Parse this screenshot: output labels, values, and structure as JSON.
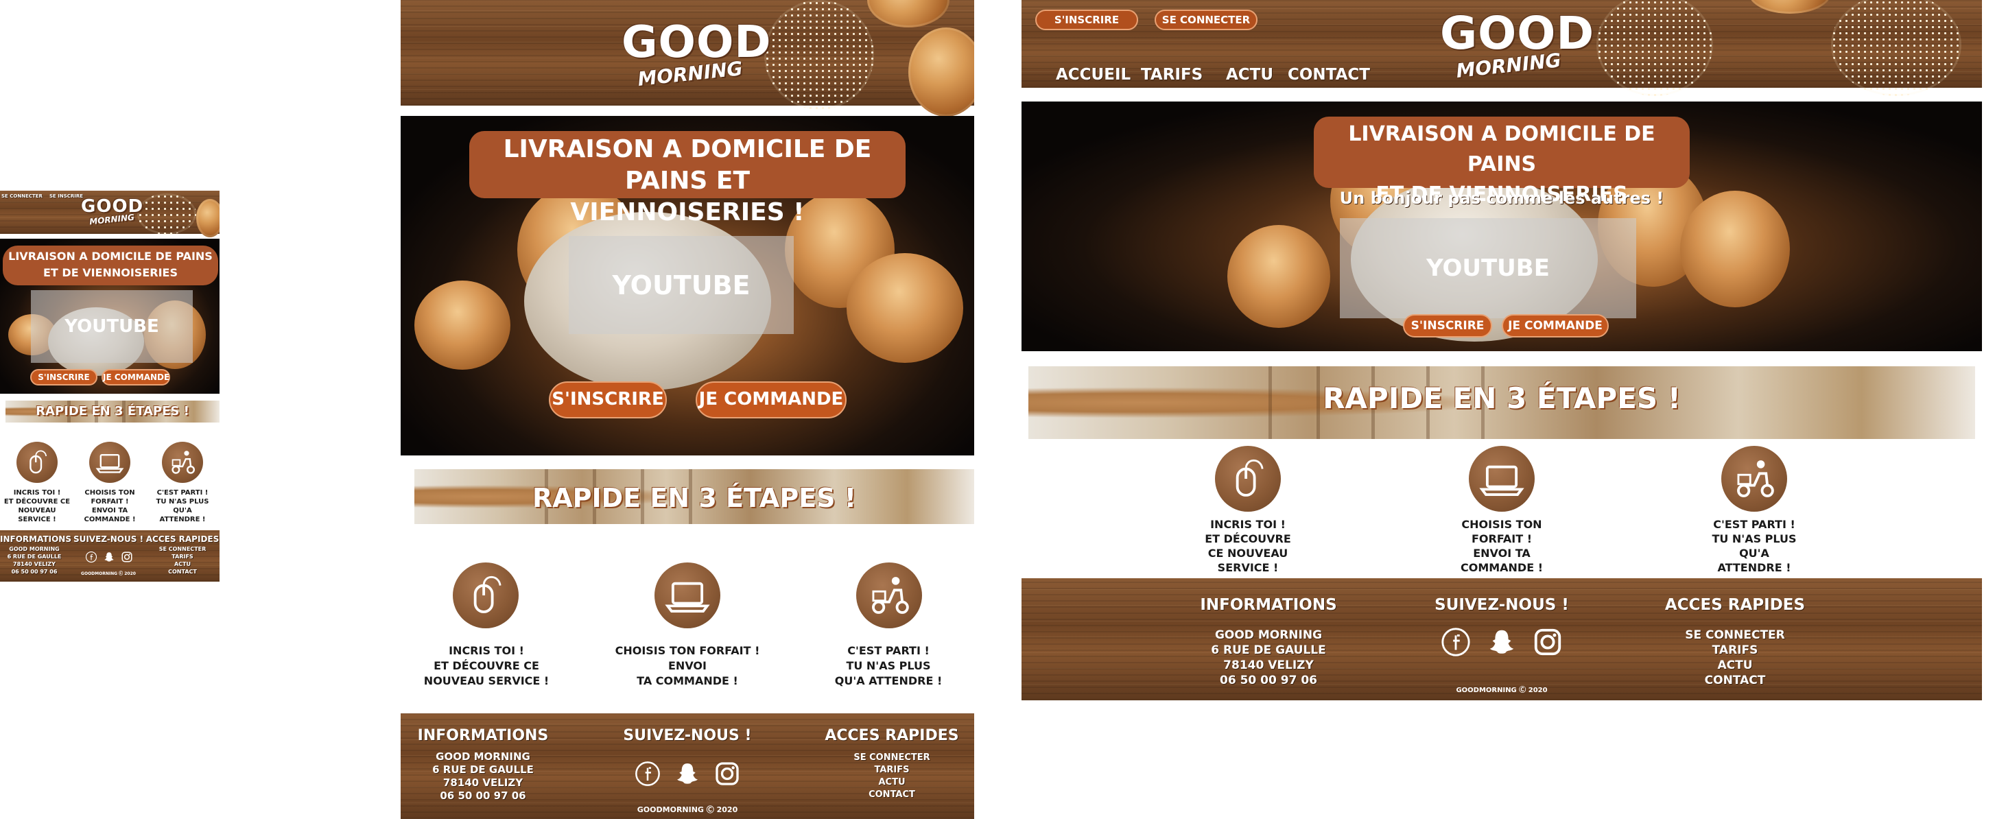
{
  "brand": {
    "logo_top": "GOOD",
    "logo_bottom": "MORNING"
  },
  "colors": {
    "accent": "#c4571e",
    "banner": "#a8532b",
    "wood": "#6f4424"
  },
  "nav": {
    "accueil": "ACCUEIL",
    "tarifs": "TARIFS",
    "actu": "ACTU",
    "contact": "CONTACT"
  },
  "auth": {
    "signup": "S'INSCRIRE",
    "login": "SE CONNECTER",
    "signup_alt": "SE INSCRIRE",
    "login_short": "SE CONNECTER"
  },
  "hero": {
    "title_desktop": "LIVRAISON A DOMICILE DE  PAINS\nET DE VIENNOISERIES",
    "title_tablet": "LIVRAISON A DOMICILE DE PAINS ET\nVIENNOISERIES !",
    "title_mobile": "LIVRAISON A DOMICILE DE  PAINS\nET DE VIENNOISERIES",
    "subtitle": "Un bonjour pas comme les autres !",
    "video_label": "YOUTUBE",
    "cta_signup": "S'INSCRIRE",
    "cta_order": "JE COMMANDE"
  },
  "steps": {
    "title": "RAPIDE EN 3 ÉTAPES !",
    "items": [
      {
        "icon": "mouse-icon",
        "desktop": "INCRIS TOI !\nET DÉCOUVRE\nCE NOUVEAU\nSERVICE !",
        "tablet": "INCRIS TOI !\nET DÉCOUVRE CE\nNOUVEAU SERVICE !",
        "mobile": "INCRIS TOI !\nET DÉCOUVRE CE\nNOUVEAU\nSERVICE !"
      },
      {
        "icon": "laptop-icon",
        "desktop": "CHOISIS TON\nFORFAIT !\nENVOI TA\nCOMMANDE !",
        "tablet": "CHOISIS TON FORFAIT !\nENVOI\nTA COMMANDE !",
        "mobile": "CHOISIS TON\nFORFAIT !\nENVOI TA\nCOMMANDE !"
      },
      {
        "icon": "delivery-scooter-icon",
        "desktop": "C'EST PARTI !\nTU N'AS PLUS\nQU'A\nATTENDRE !",
        "tablet": "C'EST PARTI !\nTU N'AS PLUS\nQU'A ATTENDRE !",
        "mobile": "C'EST PARTI !\nTU N'AS PLUS\nQU'A\nATTENDRE !"
      }
    ]
  },
  "footer": {
    "info_title": "INFORMATIONS",
    "info_lines": "GOOD MORNING\n6 RUE DE GAULLE\n78140 VELIZY\n06 50 00 97 06",
    "social_title": "SUIVEZ-NOUS !",
    "social_icons": [
      "facebook-icon",
      "snapchat-icon",
      "instagram-icon"
    ],
    "links_title": "ACCES RAPIDES",
    "links": [
      "SE CONNECTER",
      "TARIFS",
      "ACTU",
      "CONTACT"
    ],
    "copyright": "GOODMORNING Ⓒ 2020"
  }
}
